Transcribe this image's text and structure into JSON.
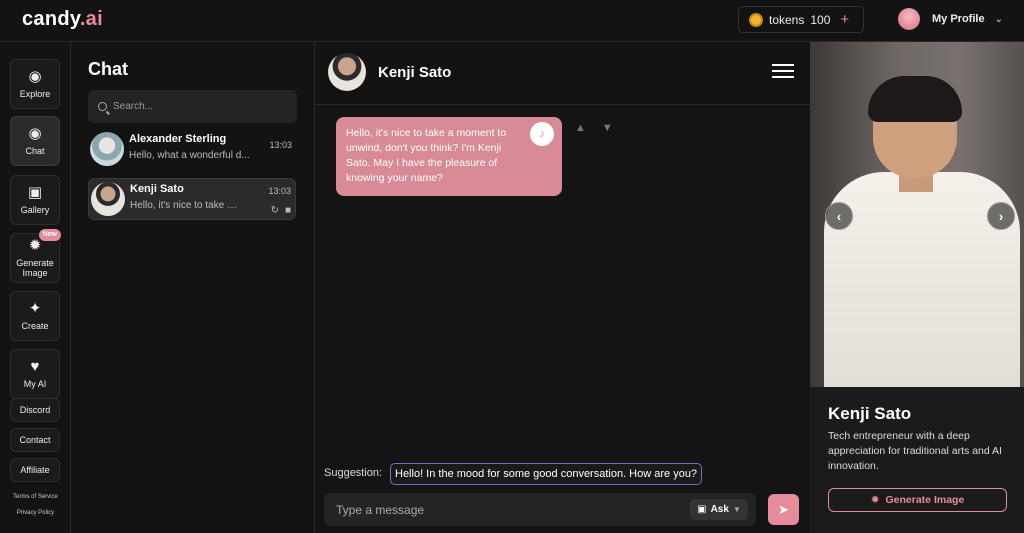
{
  "app": {
    "logo_main": "candy",
    "logo_ai": ".ai"
  },
  "tokens": {
    "label": "tokens",
    "count": "100",
    "plus": "+"
  },
  "profile": {
    "label": "My Profile"
  },
  "nav": {
    "explore": "Explore",
    "chat": "Chat",
    "gallery": "Gallery",
    "generate": "Generate Image",
    "new_badge": "New",
    "create": "Create",
    "myai": "My AI",
    "discord": "Discord",
    "contact": "Contact",
    "affiliate": "Affiliate",
    "terms": "Terms of Service",
    "privacy": "Privacy Policy"
  },
  "chatlist": {
    "title": "Chat",
    "search_placeholder": "Search...",
    "conversations": [
      {
        "name": "Alexander Sterling",
        "preview": "Hello, what a wonderful d...",
        "time": "13:03"
      },
      {
        "name": "Kenji Sato",
        "preview": "Hello, it's nice to take a moment to unwind",
        "time": "13:03"
      }
    ]
  },
  "chat": {
    "name": "Kenji Sato",
    "message": "Hello, it's nice to take a moment to unwind, don't you think? I'm Kenji Sato. May I have the pleasure of knowing your name?",
    "suggestion_label": "Suggestion:",
    "suggestion": "Hello! In the mood for some good conversation. How are you?",
    "input_placeholder": "Type a message",
    "ask_label": "Ask"
  },
  "character": {
    "name": "Kenji Sato",
    "description": "Tech entrepreneur with a deep appreciation for traditional arts and AI innovation.",
    "generate_label": "Generate Image"
  }
}
